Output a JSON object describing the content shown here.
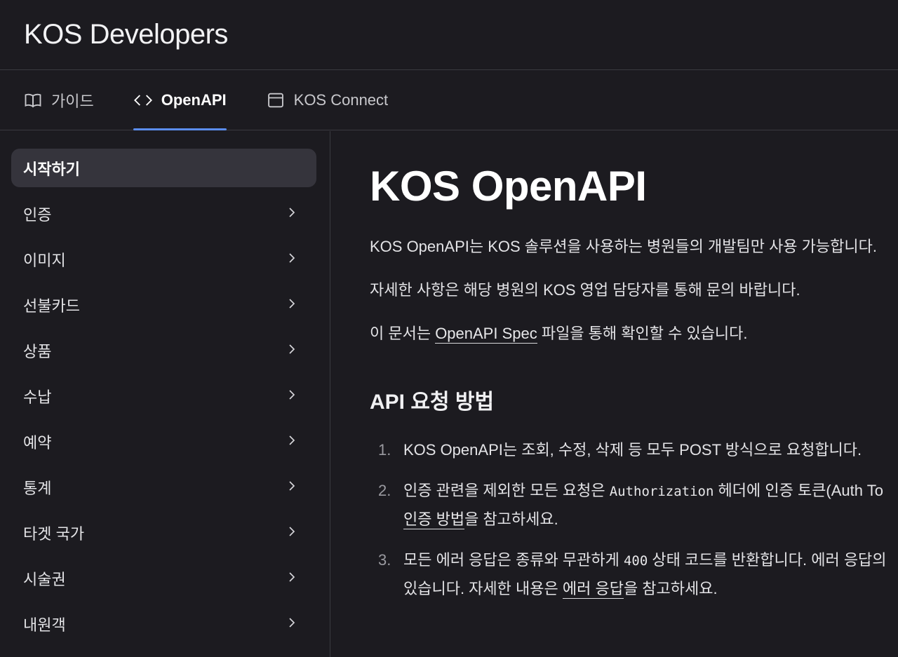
{
  "app": {
    "brand": "KOS Developers"
  },
  "tabs": [
    {
      "label": "가이드",
      "icon": "book-icon"
    },
    {
      "label": "OpenAPI",
      "icon": "code-icon",
      "active": true
    },
    {
      "label": "KOS Connect",
      "icon": "window-icon"
    }
  ],
  "sidebar": {
    "items": [
      {
        "label": "시작하기",
        "active": true
      },
      {
        "label": "인증"
      },
      {
        "label": "이미지"
      },
      {
        "label": "선불카드"
      },
      {
        "label": "상품"
      },
      {
        "label": "수납"
      },
      {
        "label": "예약"
      },
      {
        "label": "통계"
      },
      {
        "label": "타겟 국가"
      },
      {
        "label": "시술권"
      },
      {
        "label": "내원객"
      }
    ]
  },
  "main": {
    "title": "KOS OpenAPI",
    "p1": "KOS OpenAPI는 KOS 솔루션을 사용하는 병원들의 개발팀만 사용 가능합니다.",
    "p2": "자세한 사항은 해당 병원의 KOS 영업 담당자를 통해 문의 바랍니다.",
    "p3_pre": "이 문서는 ",
    "p3_link": "OpenAPI Spec",
    "p3_post": " 파일을 통해 확인할 수 있습니다.",
    "h2": "API 요청 방법",
    "list": [
      {
        "num": "1.",
        "text": "KOS OpenAPI는 조회, 수정, 삭제 등 모두 POST 방식으로 요청합니다."
      },
      {
        "num": "2.",
        "pre": "인증 관련을 제외한 모든 요청은 ",
        "code": "Authorization",
        "post": " 헤더에 인증 토큰(Auth To",
        "line2_link": "인증 방법",
        "line2_post": "을 참고하세요."
      },
      {
        "num": "3.",
        "pre": "모든 에러 응답은 종류와 무관하게 ",
        "code": "400",
        "post": " 상태 코드를 반환합니다. 에러 응답의",
        "line2_pre": "있습니다. 자세한 내용은 ",
        "line2_link": "에러 응답",
        "line2_post": "을 참고하세요."
      }
    ]
  },
  "colors": {
    "background": "#1c1b20",
    "accent": "#5b8dee",
    "active_item": "#35343c"
  }
}
